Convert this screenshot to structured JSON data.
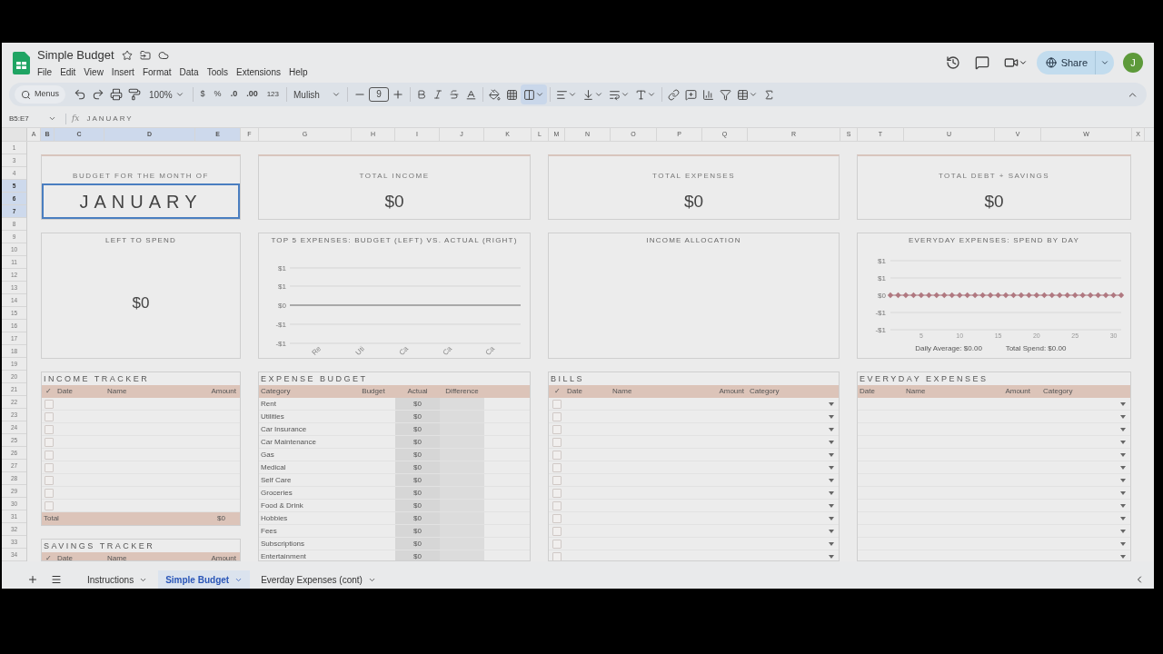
{
  "app": {
    "title": "Simple Budget",
    "menu": [
      "File",
      "Edit",
      "View",
      "Insert",
      "Format",
      "Data",
      "Tools",
      "Extensions",
      "Help"
    ],
    "share": "Share",
    "avatar": "J"
  },
  "toolbar": {
    "search_placeholder": "Menus",
    "zoom": "100%",
    "currency": "$",
    "percent": "%",
    "decrease_decimals": ".0",
    "increase_decimals": ".00",
    "number_format": "123",
    "font": "Mulish",
    "font_size": "9",
    "merge_selected": true
  },
  "formula_bar": {
    "range": "B5:E7",
    "fx": "fx",
    "value": "JANUARY"
  },
  "columns": [
    {
      "label": "A",
      "selected": false
    },
    {
      "label": "B",
      "selected": true
    },
    {
      "label": "C",
      "selected": true
    },
    {
      "label": "D",
      "selected": true
    },
    {
      "label": "E",
      "selected": true
    },
    {
      "label": "F",
      "selected": false
    },
    {
      "label": "G",
      "selected": false
    },
    {
      "label": "H",
      "selected": false
    },
    {
      "label": "I",
      "selected": false
    },
    {
      "label": "J",
      "selected": false
    },
    {
      "label": "K",
      "selected": false
    },
    {
      "label": "L",
      "selected": false
    },
    {
      "label": "M",
      "selected": false
    },
    {
      "label": "N",
      "selected": false
    },
    {
      "label": "O",
      "selected": false
    },
    {
      "label": "P",
      "selected": false
    },
    {
      "label": "Q",
      "selected": false
    },
    {
      "label": "R",
      "selected": false
    },
    {
      "label": "S",
      "selected": false
    },
    {
      "label": "T",
      "selected": false
    },
    {
      "label": "U",
      "selected": false
    },
    {
      "label": "V",
      "selected": false
    },
    {
      "label": "W",
      "selected": false
    },
    {
      "label": "X",
      "selected": false
    }
  ],
  "rows": [
    {
      "label": "1",
      "selected": false
    },
    {
      "label": "3",
      "selected": false
    },
    {
      "label": "4",
      "selected": false
    },
    {
      "label": "5",
      "selected": true
    },
    {
      "label": "6",
      "selected": true
    },
    {
      "label": "7",
      "selected": true
    },
    {
      "label": "8",
      "selected": false
    },
    {
      "label": "9",
      "selected": false
    },
    {
      "label": "10",
      "selected": false
    },
    {
      "label": "11",
      "selected": false
    },
    {
      "label": "12",
      "selected": false
    },
    {
      "label": "13",
      "selected": false
    },
    {
      "label": "14",
      "selected": false
    },
    {
      "label": "15",
      "selected": false
    },
    {
      "label": "16",
      "selected": false
    },
    {
      "label": "17",
      "selected": false
    },
    {
      "label": "18",
      "selected": false
    },
    {
      "label": "19",
      "selected": false
    },
    {
      "label": "20",
      "selected": false
    },
    {
      "label": "21",
      "selected": false
    },
    {
      "label": "22",
      "selected": false
    },
    {
      "label": "23",
      "selected": false
    },
    {
      "label": "24",
      "selected": false
    },
    {
      "label": "25",
      "selected": false
    },
    {
      "label": "26",
      "selected": false
    },
    {
      "label": "27",
      "selected": false
    },
    {
      "label": "28",
      "selected": false
    },
    {
      "label": "29",
      "selected": false
    },
    {
      "label": "30",
      "selected": false
    },
    {
      "label": "31",
      "selected": false
    },
    {
      "label": "32",
      "selected": false
    },
    {
      "label": "33",
      "selected": false
    },
    {
      "label": "34",
      "selected": false
    }
  ],
  "summary_cards": [
    {
      "label": "BUDGET FOR THE MONTH OF",
      "value": "JANUARY",
      "kind": "month",
      "selected": true
    },
    {
      "label": "TOTAL INCOME",
      "value": "$0",
      "kind": "total",
      "selected": false
    },
    {
      "label": "TOTAL EXPENSES",
      "value": "$0",
      "kind": "total",
      "selected": false
    },
    {
      "label": "TOTAL DEBT + SAVINGS",
      "value": "$0",
      "kind": "total",
      "selected": false
    }
  ],
  "left_to_spend": {
    "label": "LEFT TO SPEND",
    "value": "$0"
  },
  "top_expenses_chart": {
    "title": "TOP 5 EXPENSES: BUDGET (LEFT) VS. ACTUAL (RIGHT)",
    "y_labels": [
      "$1",
      "$1",
      "$0",
      "-$1",
      "-$1"
    ],
    "categories": [
      "Re",
      "Uti",
      "Ca",
      "Ca",
      "Ca"
    ]
  },
  "income_allocation": {
    "title": "INCOME ALLOCATION"
  },
  "everyday_chart": {
    "title": "EVERYDAY EXPENSES: SPEND BY DAY",
    "daily_average": "Daily Average: $0.00",
    "total_spend": "Total Spend: $0.00",
    "chart_data": {
      "type": "line",
      "x": [
        1,
        2,
        3,
        4,
        5,
        6,
        7,
        8,
        9,
        10,
        11,
        12,
        13,
        14,
        15,
        16,
        17,
        18,
        19,
        20,
        21,
        22,
        23,
        24,
        25,
        26,
        27,
        28,
        29,
        30,
        31
      ],
      "series": [
        {
          "color": "#b07880",
          "marker": "diamond",
          "values": [
            0,
            0,
            0,
            0,
            0,
            0,
            0,
            0,
            0,
            0,
            0,
            0,
            0,
            0,
            0,
            0,
            0,
            0,
            0,
            0,
            0,
            0,
            0,
            0,
            0,
            0,
            0,
            0,
            0,
            0,
            0
          ]
        }
      ],
      "xlim": [
        1,
        31
      ],
      "grid": true,
      "ylim": [
        -1,
        1
      ],
      "yticks": [
        {
          "value": 1,
          "label": "$1"
        },
        {
          "value": 0.5,
          "label": "$1"
        },
        {
          "value": 0,
          "label": "$0"
        },
        {
          "value": -0.5,
          "label": "-$1"
        },
        {
          "value": -1,
          "label": "-$1"
        }
      ],
      "xticks": [
        5,
        10,
        15,
        20,
        25,
        30
      ]
    }
  },
  "income_tracker": {
    "title": "INCOME TRACKER",
    "columns": [
      "✓",
      "Date",
      "Name",
      "Amount"
    ],
    "rows": [
      {
        "checked": false
      },
      {
        "checked": false
      },
      {
        "checked": false
      },
      {
        "checked": false
      },
      {
        "checked": false
      },
      {
        "checked": false
      },
      {
        "checked": false
      },
      {
        "checked": false
      },
      {
        "checked": false
      }
    ],
    "total_label": "Total",
    "total": "$0"
  },
  "savings_tracker": {
    "title": "SAVINGS TRACKER",
    "columns": [
      "✓",
      "Date",
      "Name",
      "Amount"
    ]
  },
  "expense_budget": {
    "title": "EXPENSE BUDGET",
    "columns": [
      "Category",
      "Budget",
      "Actual",
      "Difference"
    ],
    "rows": [
      {
        "category": "Rent",
        "actual": "$0"
      },
      {
        "category": "Utilities",
        "actual": "$0"
      },
      {
        "category": "Car Insurance",
        "actual": "$0"
      },
      {
        "category": "Car Maintenance",
        "actual": "$0"
      },
      {
        "category": "Gas",
        "actual": "$0"
      },
      {
        "category": "Medical",
        "actual": "$0"
      },
      {
        "category": "Self Care",
        "actual": "$0"
      },
      {
        "category": "Groceries",
        "actual": "$0"
      },
      {
        "category": "Food & Drink",
        "actual": "$0"
      },
      {
        "category": "Hobbies",
        "actual": "$0"
      },
      {
        "category": "Fees",
        "actual": "$0"
      },
      {
        "category": "Subscriptions",
        "actual": "$0"
      },
      {
        "category": "Entertainment",
        "actual": "$0"
      }
    ]
  },
  "bills": {
    "title": "BILLS",
    "columns": [
      "✓",
      "Date",
      "Name",
      "Amount",
      "Category"
    ],
    "rows": [
      {
        "checked": false
      },
      {
        "checked": false
      },
      {
        "checked": false
      },
      {
        "checked": false
      },
      {
        "checked": false
      },
      {
        "checked": false
      },
      {
        "checked": false
      },
      {
        "checked": false
      },
      {
        "checked": false
      },
      {
        "checked": false
      },
      {
        "checked": false
      },
      {
        "checked": false
      },
      {
        "checked": false
      }
    ]
  },
  "everyday_expenses": {
    "title": "EVERYDAY EXPENSES",
    "columns": [
      "Date",
      "Name",
      "Amount",
      "Category"
    ],
    "rows": [
      {
        "kind": "dropdown"
      },
      {
        "kind": "dropdown"
      },
      {
        "kind": "dropdown"
      },
      {
        "kind": "dropdown"
      },
      {
        "kind": "dropdown"
      },
      {
        "kind": "dropdown"
      },
      {
        "kind": "dropdown"
      },
      {
        "kind": "dropdown"
      },
      {
        "kind": "dropdown"
      },
      {
        "kind": "dropdown"
      },
      {
        "kind": "dropdown"
      },
      {
        "kind": "dropdown"
      },
      {
        "kind": "dropdown"
      }
    ]
  },
  "sheet_tabs": [
    {
      "label": "Instructions",
      "selected": false
    },
    {
      "label": "Simple Budget",
      "selected": true
    },
    {
      "label": "Everday Expenses (cont)",
      "selected": false
    }
  ]
}
